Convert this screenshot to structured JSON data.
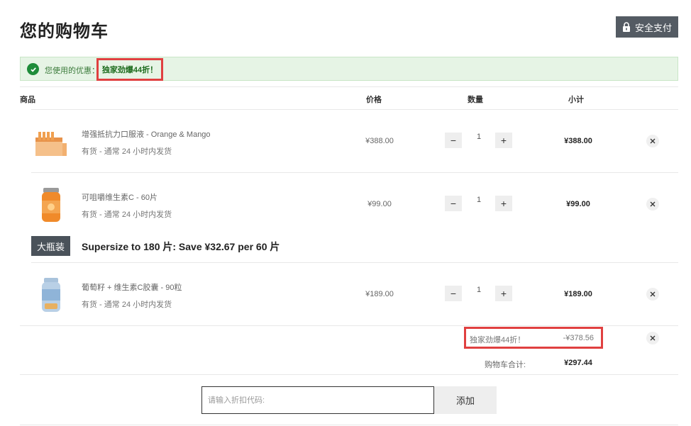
{
  "header": {
    "title": "您的购物车",
    "secure_pay_label": "安全支付"
  },
  "promo": {
    "label": "您使用的优惠：",
    "code": "独家劲爆44折！"
  },
  "columns": {
    "product": "商品",
    "price": "价格",
    "quantity": "数量",
    "subtotal": "小计"
  },
  "items": [
    {
      "name": "增强抵抗力口服液 - Orange & Mango",
      "stock": "有货  -  通常 24 小时内发货",
      "price": "¥388.00",
      "quantity": "1",
      "subtotal": "¥388.00",
      "image_color": "#f0a050"
    },
    {
      "name": "可咀嚼维生素C - 60片",
      "stock": "有货  -  通常 24 小时内发货",
      "price": "¥99.00",
      "quantity": "1",
      "subtotal": "¥99.00",
      "image_color": "#f08a2a"
    },
    {
      "name": "葡萄籽 + 维生素C胶囊 - 90粒",
      "stock": "有货  -  通常 24 小时内发货",
      "price": "¥189.00",
      "quantity": "1",
      "subtotal": "¥189.00",
      "image_color": "#8fb4d8"
    }
  ],
  "upsell": {
    "badge": "大瓶装",
    "text": "Supersize to 180 片: Save ¥32.67 per 60 片"
  },
  "discount": {
    "label": "独家劲爆44折！",
    "value": "-¥378.56"
  },
  "total": {
    "label": "购物车合计:",
    "value": "¥297.44"
  },
  "coupon": {
    "placeholder": "请输入折扣代码:",
    "add_label": "添加"
  },
  "qty_controls": {
    "minus": "−",
    "plus": "+"
  },
  "colors": {
    "secure_button": "#545b63",
    "promo_bg": "#e6f4e5",
    "check_green": "#1e8c3a",
    "highlight_red": "#e04040",
    "badge_bg": "#4a525a"
  }
}
